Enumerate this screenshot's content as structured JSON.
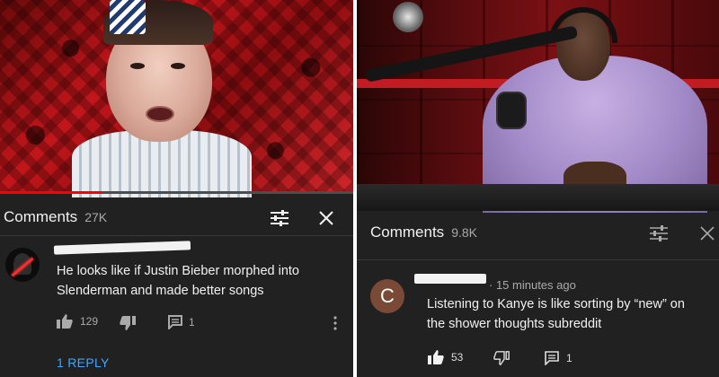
{
  "left": {
    "comments_label": "Comments",
    "comments_count": "27K",
    "comment_text_line1": "He looks like if Justin Bieber morphed into",
    "comment_text_line2": "Slenderman and made better songs",
    "like_count": "129",
    "reply_count": "1",
    "reply_link": "1 REPLY",
    "progress_fraction": 0.29
  },
  "right": {
    "comments_label": "Comments",
    "comments_count": "9.8K",
    "timestamp": "· 15 minutes ago",
    "avatar_letter": "C",
    "comment_text_line1": "Listening to Kanye is like sorting by “new” on",
    "comment_text_line2": "the shower thoughts subreddit",
    "like_count": "53",
    "reply_count": "1"
  },
  "icons": [
    "sliders-icon",
    "close-icon",
    "thumbs-up-icon",
    "thumbs-down-icon",
    "comment-icon",
    "more-vertical-icon"
  ],
  "colors": {
    "background": "#212121",
    "text": "#f1f1f1",
    "secondary": "#aaaaaa",
    "link": "#3ea6ff",
    "progress": "#ff0000"
  }
}
